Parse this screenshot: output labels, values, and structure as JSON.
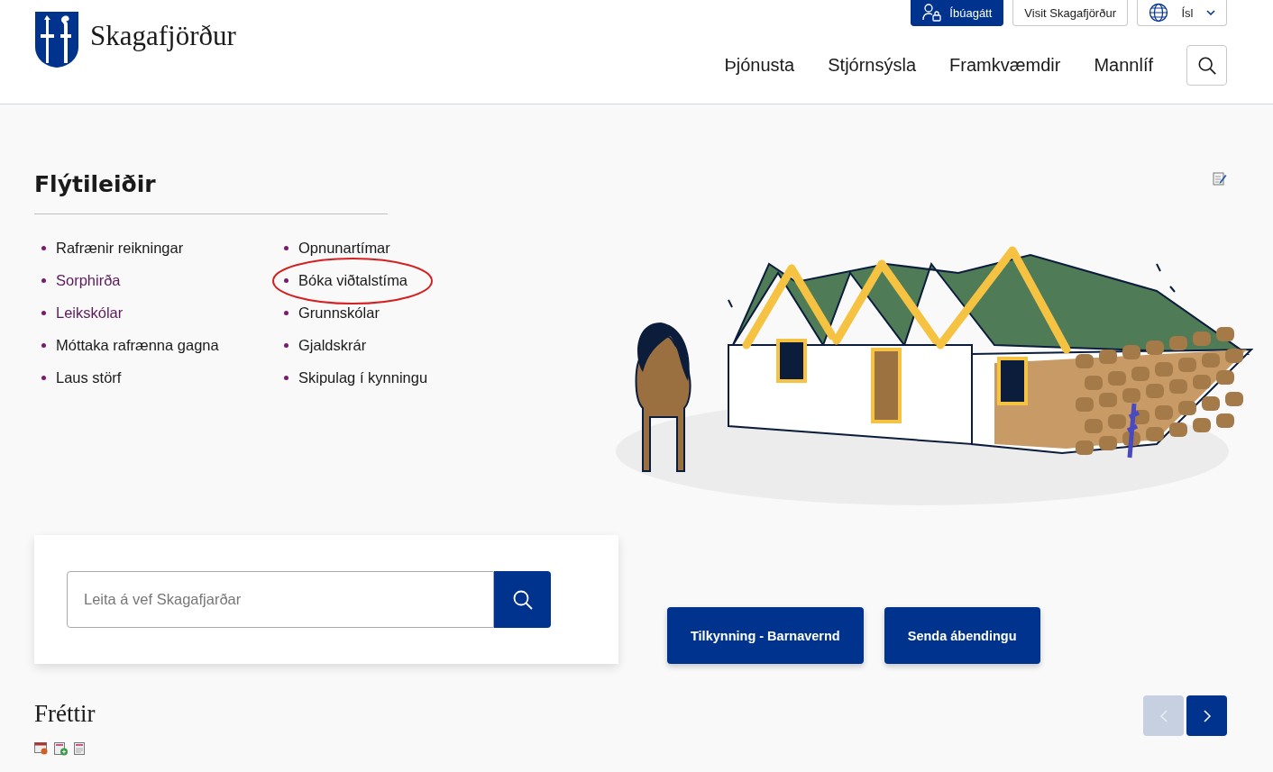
{
  "header": {
    "logo": {
      "name": "Skagafjörður"
    },
    "utility_buttons": [
      {
        "kind": "portal",
        "label": "Íbúagátt"
      },
      {
        "kind": "plain",
        "label": "Visit Skagafjörður"
      },
      {
        "kind": "language",
        "label": "Ísl"
      }
    ],
    "nav": [
      "Þjónusta",
      "Stjórnsýsla",
      "Framkvæmdir",
      "Mannlíf"
    ]
  },
  "quick_links": {
    "title": "Flýtileiðir",
    "columns": [
      [
        {
          "label": "Rafrænir reikningar",
          "visited": false,
          "circled": false
        },
        {
          "label": "Sorphirða",
          "visited": true,
          "circled": false
        },
        {
          "label": "Leikskólar",
          "visited": true,
          "circled": false
        },
        {
          "label": "Móttaka rafrænna gagna",
          "visited": false,
          "circled": false
        },
        {
          "label": "Laus störf",
          "visited": false,
          "circled": false
        }
      ],
      [
        {
          "label": "Opnunartímar",
          "visited": false,
          "circled": false
        },
        {
          "label": "Bóka viðtalstíma",
          "visited": false,
          "circled": true
        },
        {
          "label": "Grunnskólar",
          "visited": false,
          "circled": false
        },
        {
          "label": "Gjaldskrár",
          "visited": false,
          "circled": false
        },
        {
          "label": "Skipulag í kynningu",
          "visited": false,
          "circled": false
        }
      ]
    ]
  },
  "search": {
    "placeholder": "Leita á vef Skagafjarðar"
  },
  "action_buttons": [
    "Tilkynning - Barnavernd",
    "Senda ábendingu"
  ],
  "news": {
    "title": "Fréttir",
    "carousel": {
      "previous": {
        "disabled": true
      },
      "next": {
        "disabled": false
      }
    }
  }
}
